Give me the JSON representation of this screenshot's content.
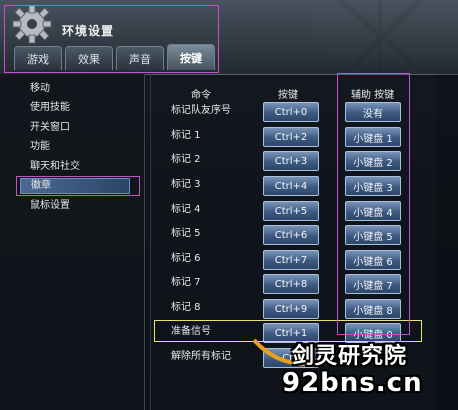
{
  "window": {
    "title": "环境设置"
  },
  "tabs": [
    {
      "label": "游戏",
      "active": false
    },
    {
      "label": "效果",
      "active": false
    },
    {
      "label": "声音",
      "active": false
    },
    {
      "label": "按键",
      "active": true
    }
  ],
  "sidebar": {
    "items": [
      {
        "label": "移动",
        "selected": false
      },
      {
        "label": "使用技能",
        "selected": false
      },
      {
        "label": "开关窗口",
        "selected": false
      },
      {
        "label": "功能",
        "selected": false
      },
      {
        "label": "聊天和社交",
        "selected": false
      },
      {
        "label": "徽章",
        "selected": true
      },
      {
        "label": "鼠标设置",
        "selected": false
      }
    ]
  },
  "columns": {
    "command": "命令",
    "key": "按键",
    "alt_key": "辅助 按键"
  },
  "rows": [
    {
      "command": "标记队友序号",
      "key": "Ctrl+0",
      "alt": "没有"
    },
    {
      "command": "标记 1",
      "key": "Ctrl+2",
      "alt": "小键盘 1"
    },
    {
      "command": "标记 2",
      "key": "Ctrl+3",
      "alt": "小键盘 2"
    },
    {
      "command": "标记 3",
      "key": "Ctrl+4",
      "alt": "小键盘 3"
    },
    {
      "command": "标记 4",
      "key": "Ctrl+5",
      "alt": "小键盘 4"
    },
    {
      "command": "标记 5",
      "key": "Ctrl+6",
      "alt": "小键盘 5"
    },
    {
      "command": "标记 6",
      "key": "Ctrl+7",
      "alt": "小键盘 6"
    },
    {
      "command": "标记 7",
      "key": "Ctrl+8",
      "alt": "小键盘 7"
    },
    {
      "command": "标记 8",
      "key": "Ctrl+9",
      "alt": "小键盘 8"
    },
    {
      "command": "准备信号",
      "key": "Ctrl+1",
      "alt": "小键盘 0"
    },
    {
      "command": "解除所有标记",
      "key": "Ctrl",
      "alt": ""
    }
  ],
  "watermark": {
    "name": "剑灵研究院",
    "url": "92bns.cn"
  },
  "colors": {
    "highlight_purple": "#c64fd0",
    "highlight_yellow": "#e8e070",
    "button_blue": "#3e5a82"
  },
  "icons": {
    "app": "gear-icon"
  }
}
